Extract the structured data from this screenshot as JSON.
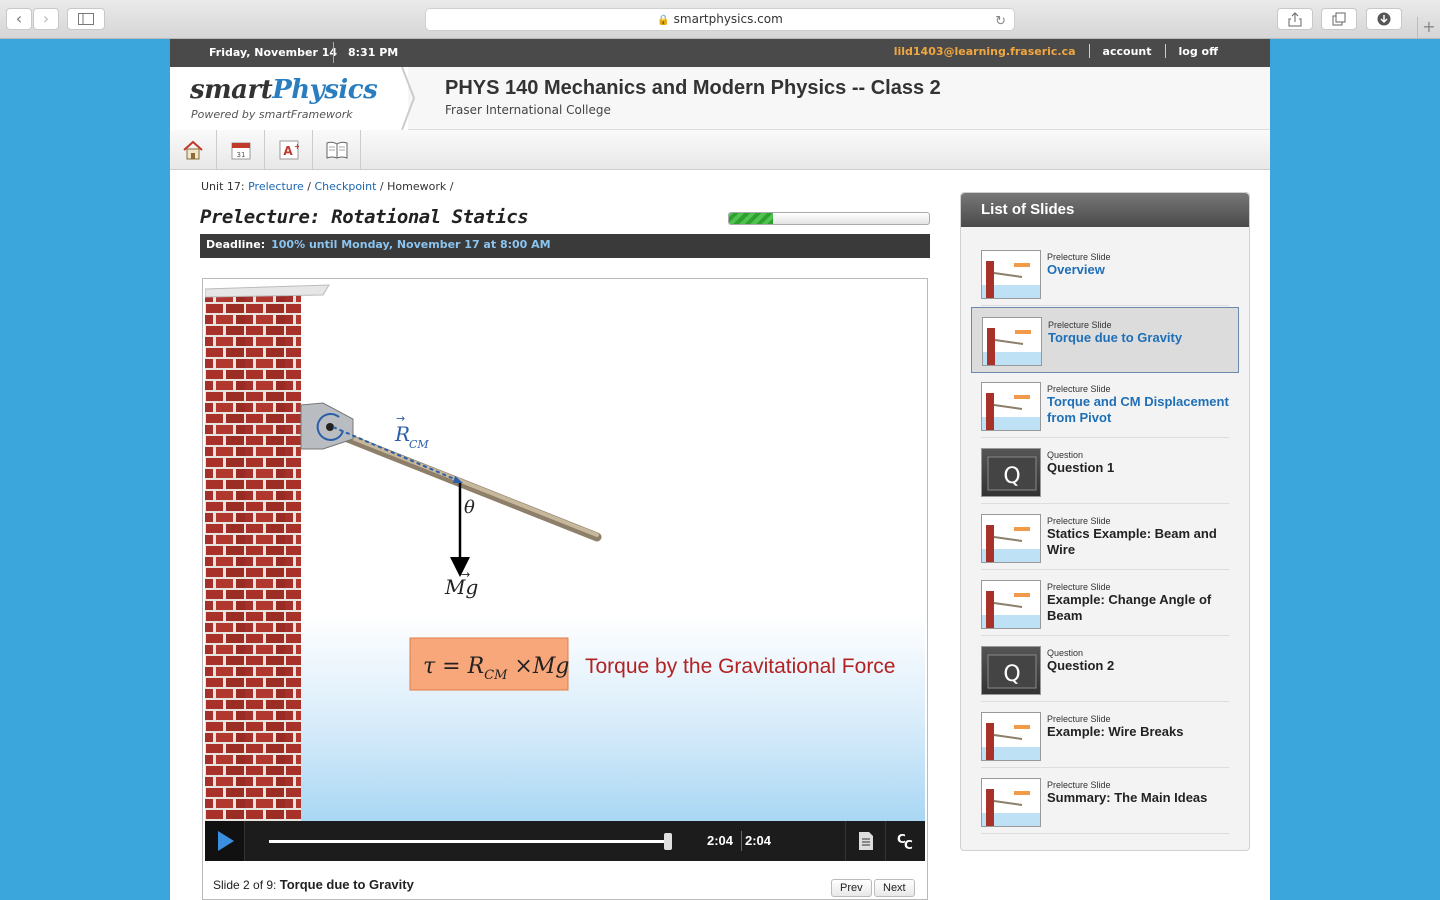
{
  "browser": {
    "url": "smartphysics.com"
  },
  "topbar": {
    "date": "Friday, November 14",
    "time": "8:31 PM",
    "email": "lild1403@learning.fraseric.ca",
    "account": "account",
    "logoff": "log off"
  },
  "header": {
    "logo_smart": "smart",
    "logo_physics": "Physics",
    "logo_sub": "Powered by smartFramework",
    "course_title": "PHYS 140 Mechanics and Modern Physics -- Class 2",
    "course_sub": "Fraser International College"
  },
  "breadcrumb": {
    "unit": "Unit 17:",
    "prelecture": "Prelecture",
    "checkpoint": "Checkpoint",
    "homework": "Homework"
  },
  "lecture": {
    "title": "Prelecture: Rotational Statics",
    "progress": 0.22,
    "deadline_label": "Deadline:",
    "deadline_value": "100% until Monday, November 17 at 8:00 AM"
  },
  "slide": {
    "caption": "Torque by the Gravitational Force",
    "theta": "θ"
  },
  "player": {
    "current": "2:04",
    "total": "2:04",
    "position": 1.0
  },
  "footer": {
    "slide_info": "Slide 2 of 9:",
    "slide_name": "Torque due to Gravity",
    "prev": "Prev",
    "next": "Next"
  },
  "sidebar": {
    "title": "List of Slides",
    "items": [
      {
        "kind": "Prelecture Slide",
        "name": "Overview",
        "link": true
      },
      {
        "kind": "Prelecture Slide",
        "name": "Torque due to Gravity",
        "link": true
      },
      {
        "kind": "Prelecture Slide",
        "name": "Torque and CM Displacement from Pivot",
        "link": true
      },
      {
        "kind": "Question",
        "name": "Question 1",
        "link": false
      },
      {
        "kind": "Prelecture Slide",
        "name": "Statics Example: Beam and Wire",
        "link": false
      },
      {
        "kind": "Prelecture Slide",
        "name": "Example: Change Angle of Beam",
        "link": false
      },
      {
        "kind": "Question",
        "name": "Question 2",
        "link": false
      },
      {
        "kind": "Prelecture Slide",
        "name": "Example: Wire Breaks",
        "link": false
      },
      {
        "kind": "Prelecture Slide",
        "name": "Summary: The Main Ideas",
        "link": false
      }
    ]
  }
}
